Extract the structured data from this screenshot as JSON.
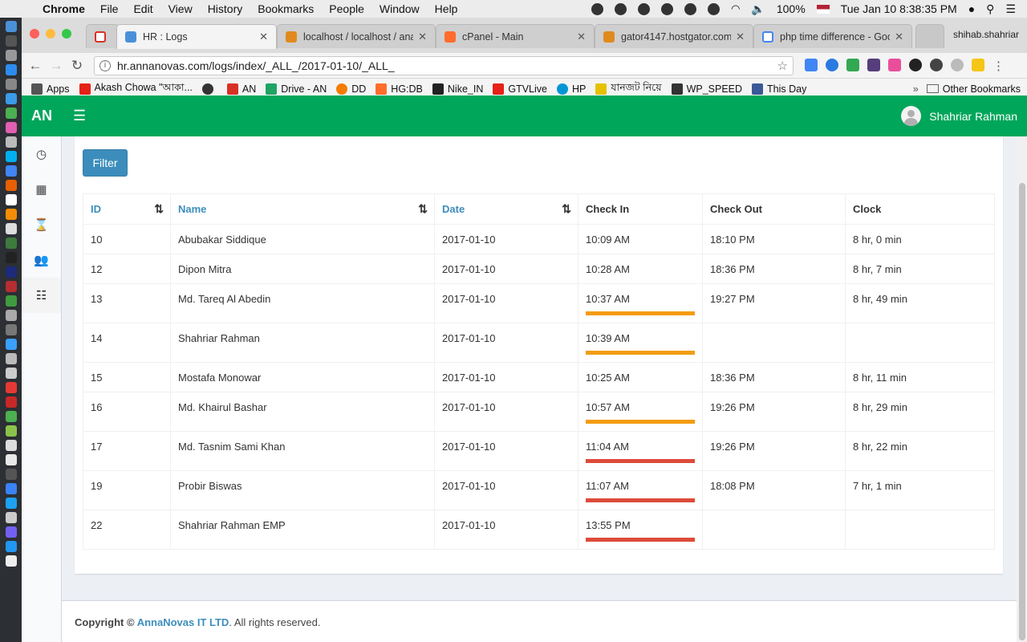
{
  "menubar": {
    "app": "Chrome",
    "items": [
      "File",
      "Edit",
      "View",
      "History",
      "Bookmarks",
      "People",
      "Window",
      "Help"
    ],
    "battery": "100%",
    "datetime": "Tue Jan 10  8:38:35 PM"
  },
  "tabs": [
    {
      "title": "",
      "icon": "gmail-icon",
      "color": "#d93025"
    },
    {
      "title": "HR : Logs",
      "icon": "app-icon",
      "color": "#4a90d9"
    },
    {
      "title": "localhost / localhost / ana",
      "icon": "pma-icon",
      "color": "#e08a1e"
    },
    {
      "title": "cPanel - Main",
      "icon": "cpanel-icon",
      "color": "#ff6c2c"
    },
    {
      "title": "gator4147.hostgator.com",
      "icon": "pma-icon",
      "color": "#e08a1e"
    },
    {
      "title": "php time difference - Goo",
      "icon": "google-icon",
      "color": "#4285f4"
    }
  ],
  "profile_name": "shihab.shahriar",
  "address": "hr.annanovas.com/logs/index/_ALL_/2017-01-10/_ALL_",
  "bookmarks": [
    {
      "label": "Apps",
      "color": "#555"
    },
    {
      "label": "Akash Chowa \"আকা...",
      "color": "#e62117"
    },
    {
      "label": "",
      "color": "#333"
    },
    {
      "label": "AN",
      "color": "#d93025"
    },
    {
      "label": "Drive - AN",
      "color": "#1fa463"
    },
    {
      "label": "DD",
      "color": "#f57c00"
    },
    {
      "label": "HG:DB",
      "color": "#ff6c2c"
    },
    {
      "label": "Nike_IN",
      "color": "#222"
    },
    {
      "label": "GTVLive",
      "color": "#e62117"
    },
    {
      "label": "HP",
      "color": "#0096d6"
    },
    {
      "label": "যানজট নিয়ে",
      "color": "#e5c100"
    },
    {
      "label": "WP_SPEED",
      "color": "#333"
    },
    {
      "label": "This Day",
      "color": "#3b5998"
    }
  ],
  "other_bookmarks": "Other Bookmarks",
  "app": {
    "logo": "AN",
    "user": "Shahriar Rahman",
    "filter_label": "Filter",
    "columns": [
      "ID",
      "Name",
      "Date",
      "Check In",
      "Check Out",
      "Clock"
    ],
    "rows": [
      {
        "id": "10",
        "name": "Abubakar Siddique",
        "date": "2017-01-10",
        "check_in": "10:09 AM",
        "check_out": "18:10 PM",
        "clock": "8 hr, 0 min",
        "bar": ""
      },
      {
        "id": "12",
        "name": "Dipon Mitra",
        "date": "2017-01-10",
        "check_in": "10:28 AM",
        "check_out": "18:36 PM",
        "clock": "8 hr, 7 min",
        "bar": ""
      },
      {
        "id": "13",
        "name": "Md. Tareq Al Abedin",
        "date": "2017-01-10",
        "check_in": "10:37 AM",
        "check_out": "19:27 PM",
        "clock": "8 hr, 49 min",
        "bar": "#f39c12"
      },
      {
        "id": "14",
        "name": "Shahriar Rahman",
        "date": "2017-01-10",
        "check_in": "10:39 AM",
        "check_out": "",
        "clock": "",
        "bar": "#f39c12"
      },
      {
        "id": "15",
        "name": "Mostafa Monowar",
        "date": "2017-01-10",
        "check_in": "10:25 AM",
        "check_out": "18:36 PM",
        "clock": "8 hr, 11 min",
        "bar": ""
      },
      {
        "id": "16",
        "name": "Md. Khairul Bashar",
        "date": "2017-01-10",
        "check_in": "10:57 AM",
        "check_out": "19:26 PM",
        "clock": "8 hr, 29 min",
        "bar": "#f39c12"
      },
      {
        "id": "17",
        "name": "Md. Tasnim Sami Khan",
        "date": "2017-01-10",
        "check_in": "11:04 AM",
        "check_out": "19:26 PM",
        "clock": "8 hr, 22 min",
        "bar": "#dd4b39"
      },
      {
        "id": "19",
        "name": "Probir Biswas",
        "date": "2017-01-10",
        "check_in": "11:07 AM",
        "check_out": "18:08 PM",
        "clock": "7 hr, 1 min",
        "bar": "#dd4b39"
      },
      {
        "id": "22",
        "name": "Shahriar Rahman EMP",
        "date": "2017-01-10",
        "check_in": "13:55 PM",
        "check_out": "",
        "clock": "",
        "bar": "#dd4b39"
      }
    ],
    "footer": {
      "prefix": "Copyright © ",
      "company": "AnnaNovas IT LTD",
      "suffix": ". All rights reserved."
    }
  }
}
